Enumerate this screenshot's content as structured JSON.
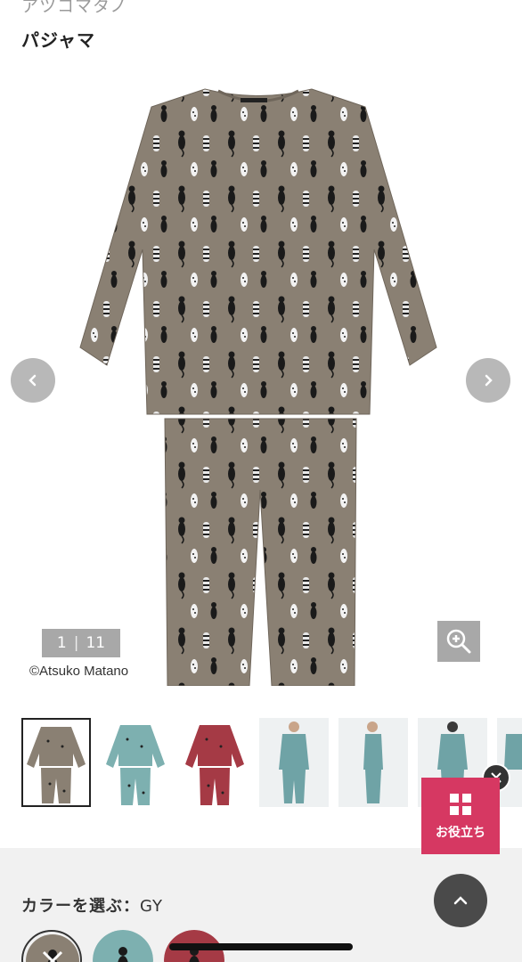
{
  "header": {
    "brand": "アツコマタノ",
    "title": "パジャマ"
  },
  "gallery": {
    "current": "1",
    "separator": "|",
    "total": "11",
    "copyright": "©Atsuko Matano"
  },
  "thumbnails": [
    {
      "color": "#8a8073"
    },
    {
      "color": "#7db0b0"
    },
    {
      "color": "#a53a45"
    },
    {
      "color": "#6fa3a6"
    },
    {
      "color": "#6fa3a6"
    },
    {
      "color": "#6fa3a6"
    },
    {
      "color": "#6fa3a6"
    }
  ],
  "color_select": {
    "label": "カラーを選ぶ：",
    "value": "GY"
  },
  "floating": {
    "helper_label": "お役立ち"
  },
  "colors": {
    "accent": "#d63862",
    "nav_bg": "#b8b8b8",
    "pajama_gray": "#8a8073"
  }
}
